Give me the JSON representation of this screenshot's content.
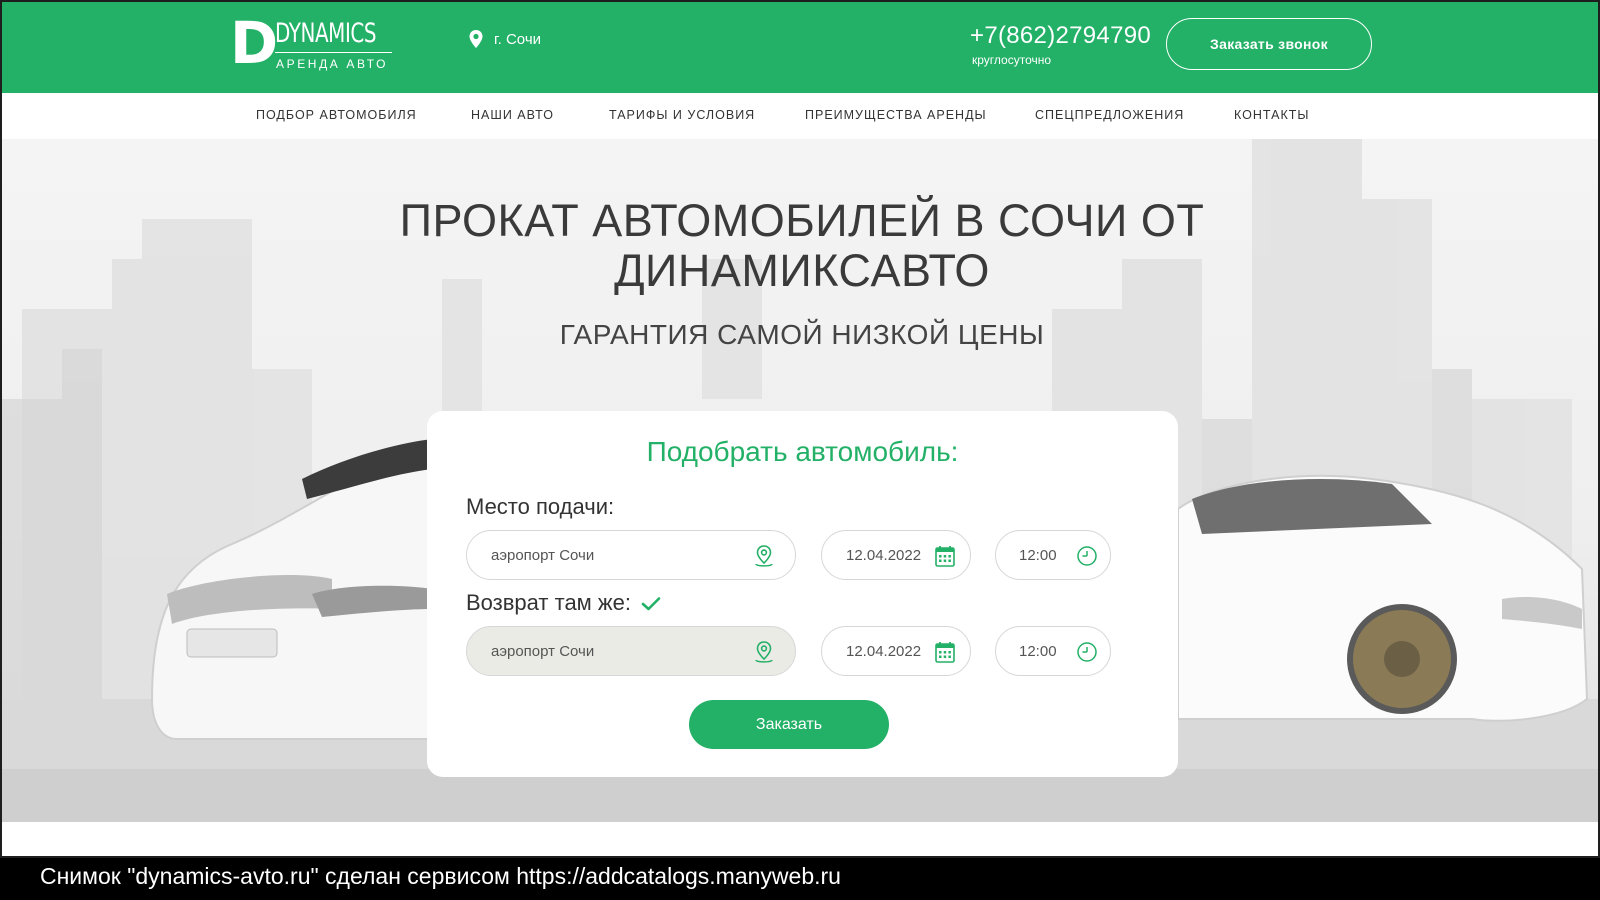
{
  "header": {
    "logo_letter": "D",
    "logo_name": "DYNAMICS",
    "logo_sub": "АРЕНДА АВТО",
    "city": "г. Сочи",
    "phone": "+7(862)2794790",
    "phone_note": "круглосуточно",
    "callback_label": "Заказать звонок"
  },
  "nav": {
    "items": [
      "ПОДБОР АВТОМОБИЛЯ",
      "НАШИ АВТО",
      "ТАРИФЫ И УСЛОВИЯ",
      "ПРЕИМУЩЕСТВА АРЕНДЫ",
      "СПЕЦПРЕДЛОЖЕНИЯ",
      "КОНТАКТЫ"
    ]
  },
  "hero": {
    "title_line1": "ПРОКАТ АВТОМОБИЛЕЙ В СОЧИ ОТ",
    "title_line2": "ДИНАМИКСАВТО",
    "subtitle": "ГАРАНТИЯ САМОЙ НИЗКОЙ ЦЕНЫ"
  },
  "form": {
    "title": "Подобрать автомобиль:",
    "pickup_label": "Место подачи:",
    "pickup_place": "аэропорт Сочи",
    "pickup_date": "12.04.2022",
    "pickup_time": "12:00",
    "return_label": "Возврат там же:",
    "return_same_checked": true,
    "return_place": "аэропорт Сочи",
    "return_date": "12.04.2022",
    "return_time": "12:00",
    "submit_label": "Заказать"
  },
  "colors": {
    "brand_green": "#23b067",
    "background": "#efefef"
  },
  "caption": {
    "text": "Снимок \"dynamics-avto.ru\" сделан сервисом https://addcatalogs.manyweb.ru"
  }
}
